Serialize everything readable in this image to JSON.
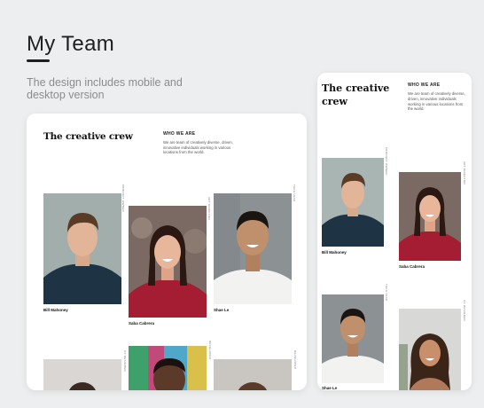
{
  "page": {
    "title": "My Team",
    "subtitle": "The design includes mobile and desktop version"
  },
  "desktop": {
    "heading": "The creative crew",
    "who_heading": "WHO WE ARE",
    "who_text": "We are team of creatively diverse, driven, innovative individuals working in various locations from the world.",
    "members": [
      {
        "name": "Bill Mahoney",
        "role": "PRODUCT OWNER"
      },
      {
        "name": "Saba Cabrera",
        "role": "ART DIRECTOR"
      },
      {
        "name": "Shae Le",
        "role": "TECH LEAD"
      },
      {
        "name": "",
        "role": "UX DESIGNER"
      },
      {
        "name": "",
        "role": "DEVELOPER"
      },
      {
        "name": "",
        "role": "DEVELOPER"
      }
    ]
  },
  "mobile": {
    "heading": "The creative crew",
    "who_heading": "WHO WE ARE",
    "who_text": "We are team of creatively diverse, driven, innovative individuals working in various locations from the world.",
    "members": [
      {
        "name": "Bill Mahoney",
        "role": "PRODUCT OWNER"
      },
      {
        "name": "Saba Cabrera",
        "role": "ART DIRECTOR"
      },
      {
        "name": "Shae Le",
        "role": "TECH LEAD"
      },
      {
        "name": "",
        "role": "UX DESIGNER"
      }
    ]
  },
  "colors": {
    "background": "#eceeef",
    "card": "#ffffff",
    "accent_text": "#1f1f1f",
    "subtitle": "#8a8d90"
  }
}
